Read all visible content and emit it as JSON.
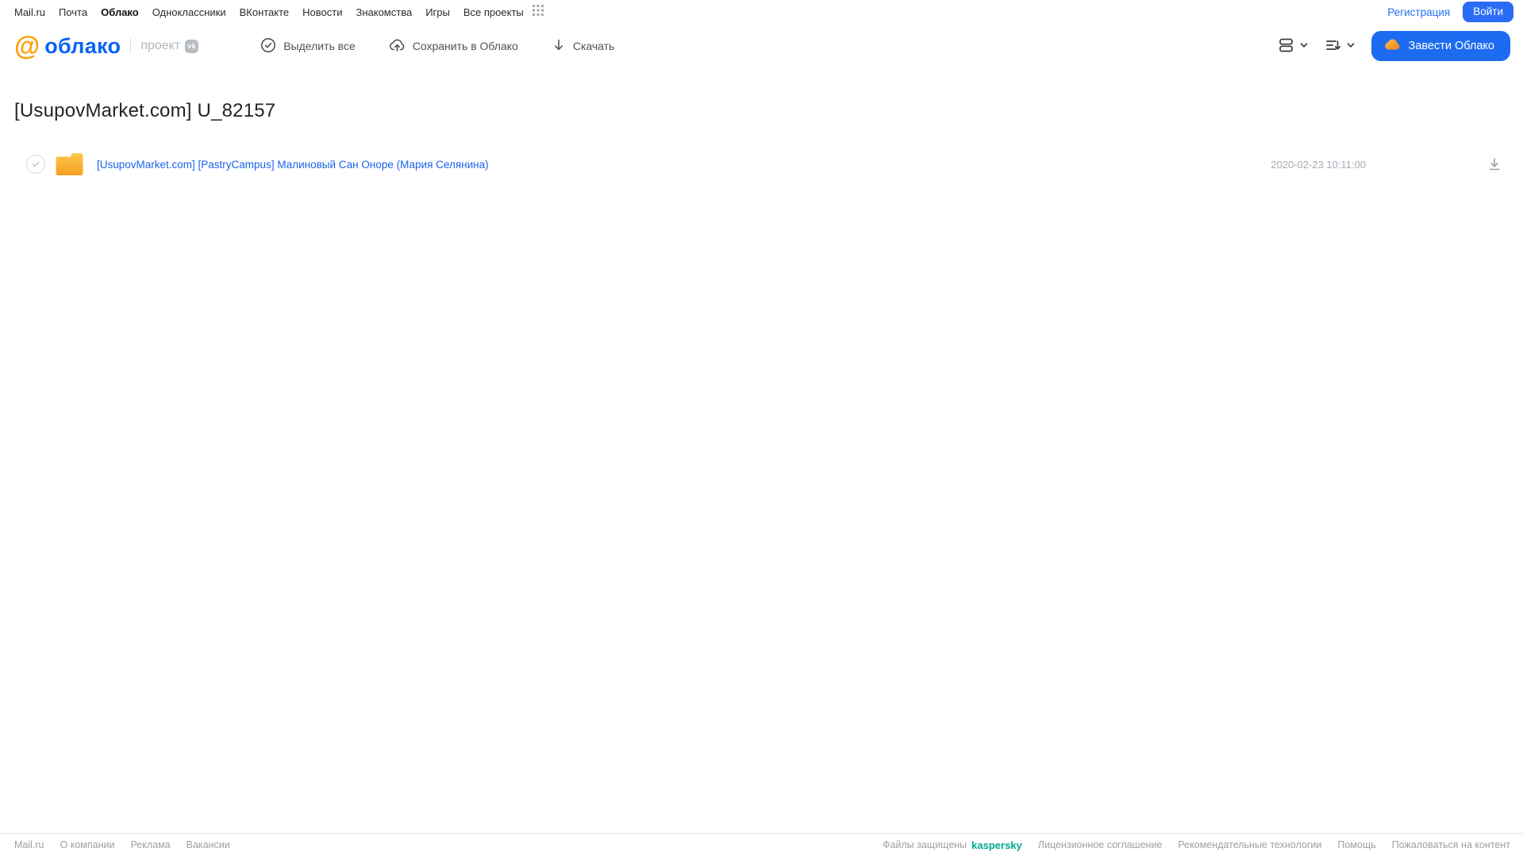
{
  "topbar": {
    "links": [
      "Mail.ru",
      "Почта",
      "Облако",
      "Одноклассники",
      "ВКонтакте",
      "Новости",
      "Знакомства",
      "Игры",
      "Все проекты"
    ],
    "active_link": "Облако",
    "registration_label": "Регистрация",
    "login_label": "Войти"
  },
  "header": {
    "logo_text": "облако",
    "project_label": "проект",
    "vk_badge": "vk",
    "actions": {
      "select_all": "Выделить все",
      "save_to_cloud": "Сохранить в Облако",
      "download": "Скачать"
    },
    "get_cloud_button": "Завести Облако"
  },
  "main": {
    "title": "[UsupovMarket.com] U_82157",
    "files": [
      {
        "type": "folder",
        "name": "[UsupovMarket.com] [PastryCampus] Малиновый Сан Оноре (Мария Селянина)",
        "date": "2020-02-23 10:11:00"
      }
    ]
  },
  "footer": {
    "left_links": [
      "Mail.ru",
      "О компании",
      "Реклама",
      "Вакансии"
    ],
    "protected_label": "Файлы защищены",
    "kaspersky_label": "kaspersky",
    "right_links": [
      "Лицензионное соглашение",
      "Рекомендательные технологии",
      "Помощь",
      "Пожаловаться на контент"
    ]
  },
  "colors": {
    "brand_blue": "#0B63F6",
    "brand_orange": "#FF9E00",
    "button_blue": "#1d6bf0",
    "link_blue": "#1b63e8",
    "kaspersky_green": "#00A88E",
    "folder_top": "#FCC84C",
    "folder_bottom": "#F5A01F"
  }
}
